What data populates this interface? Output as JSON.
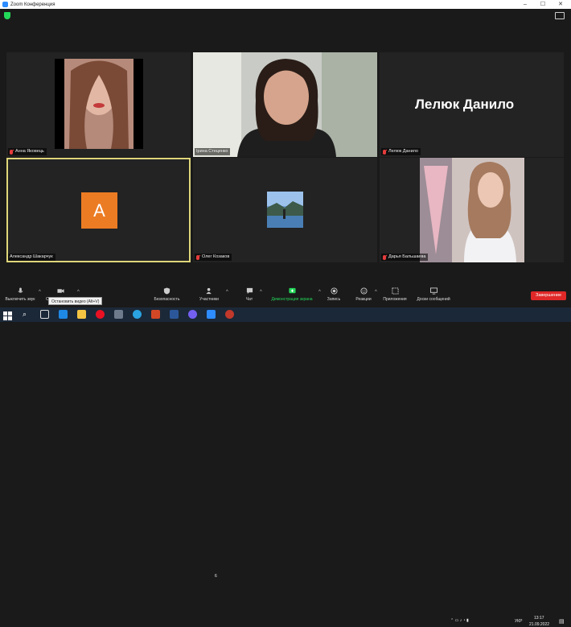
{
  "window": {
    "title": "Zoom Конференция"
  },
  "participants": [
    {
      "name": "Анна Яковець",
      "muted": true
    },
    {
      "name": "Ірина Стеценко",
      "muted": false
    },
    {
      "name": "Лелюк Данило",
      "muted": true,
      "display_name": "Лелюк Данило"
    },
    {
      "name": "Александр Шакарчук",
      "muted": false,
      "avatar_letter": "A"
    },
    {
      "name": "Олег Козаков",
      "muted": true
    },
    {
      "name": "Дарья Бальшаева",
      "muted": true
    }
  ],
  "toolbar": {
    "mute_label": "Выключить звук",
    "video_label": "Ос",
    "security_label": "Безопасность",
    "participants_label": "Участники",
    "participants_count": "6",
    "chat_label": "Чат",
    "share_label": "Демонстрация экрана",
    "record_label": "Запись",
    "reactions_label": "Реакции",
    "apps_label": "Приложения",
    "whiteboard_label": "Доски сообщений",
    "end_label": "Завершение",
    "tooltip": "Остановить видео (Alt+V)"
  },
  "taskbar": {
    "time": "13:17",
    "date": "21.09.2022",
    "lang": "УКР"
  },
  "colors": {
    "accent_green": "#23d959",
    "end_red": "#e02828",
    "active_border": "#dfd67a",
    "avatar_orange": "#ec7c23"
  }
}
